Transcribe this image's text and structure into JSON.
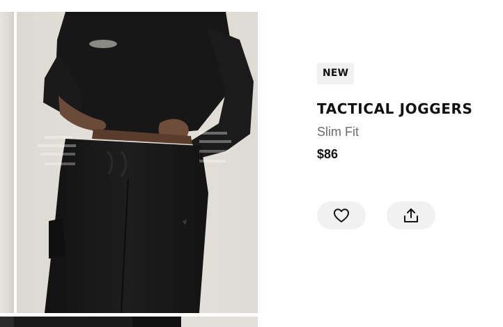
{
  "product": {
    "badge": "NEW",
    "name": "TACTICAL JOGGERS",
    "fit": "Slim Fit",
    "price": "$86"
  },
  "gallery": {
    "main_image": "model wearing black tactical joggers and black sweatshirt",
    "background_color": "#e2ded8",
    "garment_color": "#161616"
  },
  "actions": {
    "wishlist_icon": "heart-icon",
    "share_icon": "share-upload-icon"
  }
}
